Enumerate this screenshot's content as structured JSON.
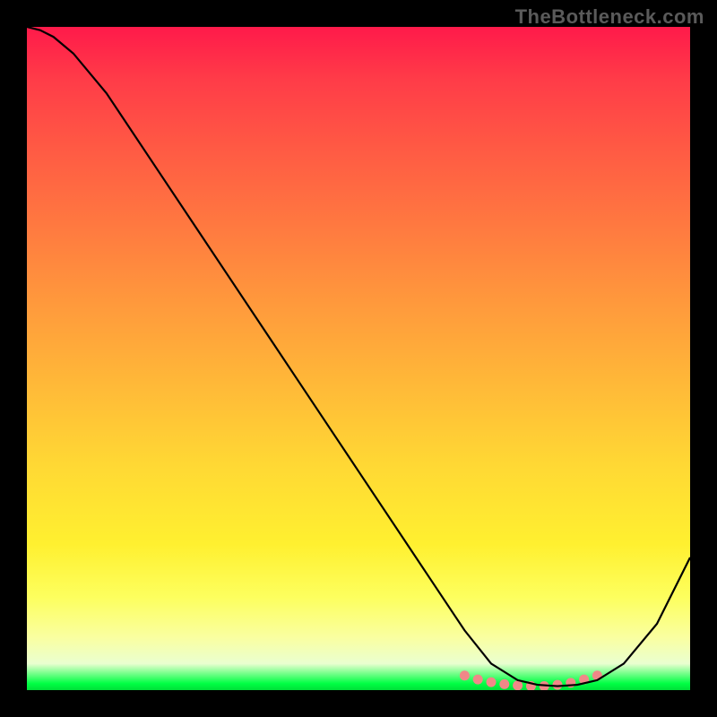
{
  "watermark": "TheBottleneck.com",
  "chart_data": {
    "type": "line",
    "title": "",
    "xlabel": "",
    "ylabel": "",
    "xlim": [
      0,
      100
    ],
    "ylim": [
      0,
      100
    ],
    "grid": false,
    "series": [
      {
        "name": "curve",
        "color": "#000000",
        "x": [
          0,
          2,
          4,
          7,
          12,
          20,
          30,
          40,
          50,
          60,
          66,
          70,
          74,
          77,
          80,
          83,
          86,
          90,
          95,
          100
        ],
        "y": [
          100,
          99.5,
          98.5,
          96,
          90,
          78,
          63,
          48,
          33,
          18,
          9,
          4,
          1.5,
          0.8,
          0.6,
          0.8,
          1.5,
          4,
          10,
          20
        ]
      }
    ],
    "highlight": {
      "name": "trough-band",
      "color": "#f08888",
      "x": [
        66,
        68,
        70,
        72,
        74,
        76,
        78,
        80,
        82,
        84,
        86
      ],
      "y": [
        2.2,
        1.6,
        1.2,
        0.9,
        0.7,
        0.6,
        0.6,
        0.8,
        1.1,
        1.6,
        2.2
      ]
    }
  }
}
